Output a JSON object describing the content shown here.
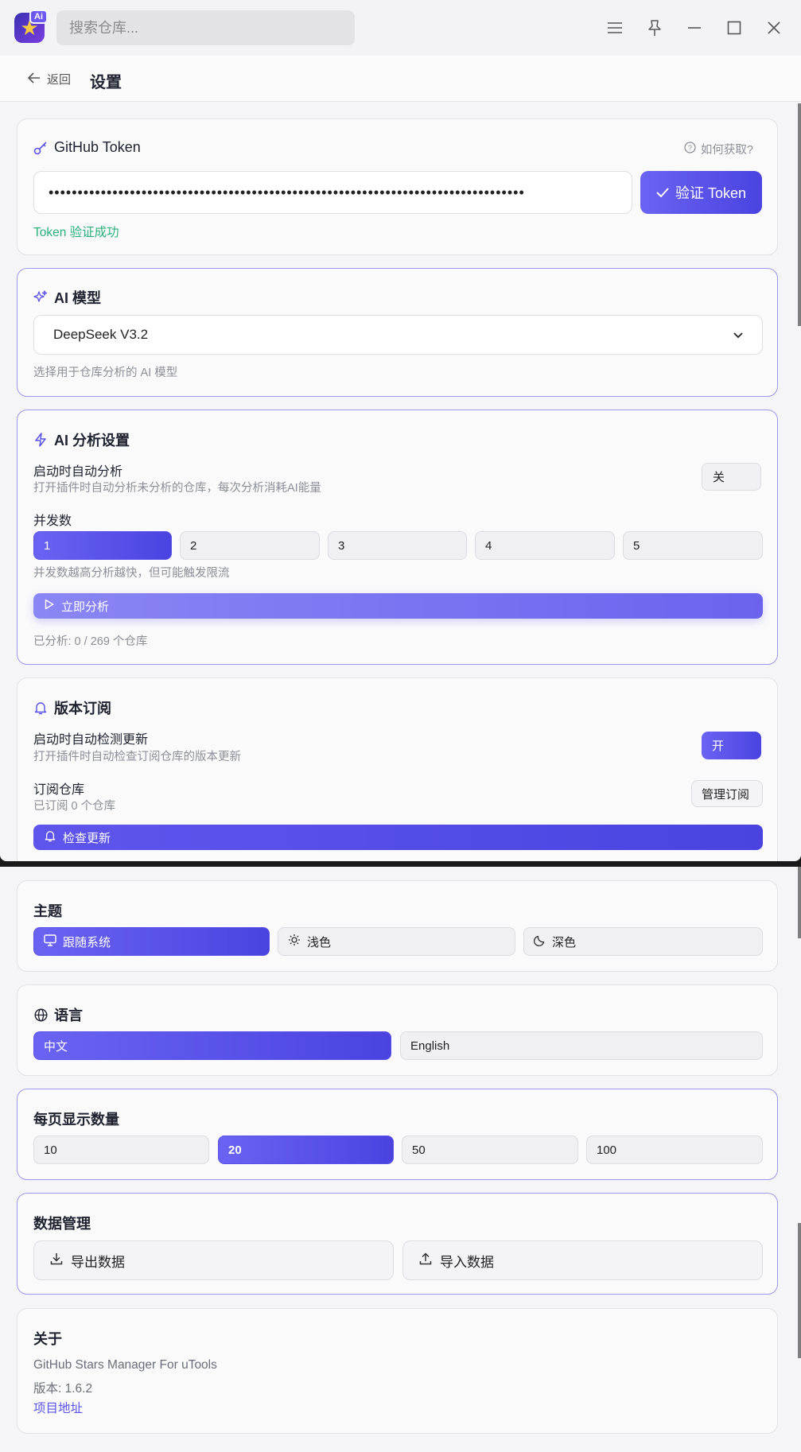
{
  "search": {
    "placeholder": "搜索仓库..."
  },
  "header": {
    "back_label": "返回",
    "title": "设置"
  },
  "token": {
    "title": "GitHub Token",
    "help": "如何获取?",
    "value": "••••••••••••••••••••••••••••••••••••••••••••••••••••••••••••••••••••••••••••••••••",
    "verify_label": "验证 Token",
    "status": "Token 验证成功"
  },
  "model": {
    "title": "AI 模型",
    "selected": "DeepSeek V3.2",
    "hint": "选择用于仓库分析的 AI 模型"
  },
  "analysis": {
    "title": "AI 分析设置",
    "auto_label": "启动时自动分析",
    "auto_hint": "打开插件时自动分析未分析的仓库，每次分析消耗AI能量",
    "auto_value": "关",
    "concurrency_label": "并发数",
    "concurrency_options": [
      "1",
      "2",
      "3",
      "4",
      "5"
    ],
    "concurrency_selected": 1,
    "concurrency_hint": "并发数越高分析越快，但可能触发限流",
    "analyze_label": "立即分析",
    "progress": "已分析: 0 / 269 个仓库"
  },
  "subscription": {
    "title": "版本订阅",
    "auto_label": "启动时自动检测更新",
    "auto_hint": "打开插件时自动检查订阅仓库的版本更新",
    "auto_value": "开",
    "repo_label": "订阅仓库",
    "repo_hint": "已订阅 0 个仓库",
    "manage_label": "管理订阅",
    "check_label": "检查更新"
  },
  "theme": {
    "title": "主题",
    "options": [
      "跟随系统",
      "浅色",
      "深色"
    ],
    "selected": "跟随系统"
  },
  "language": {
    "title": "语言",
    "options": [
      "中文",
      "English"
    ],
    "selected": "中文"
  },
  "page_size": {
    "title": "每页显示数量",
    "options": [
      "10",
      "20",
      "50",
      "100"
    ],
    "selected": "20"
  },
  "data_mgmt": {
    "title": "数据管理",
    "export_label": "导出数据",
    "import_label": "导入数据"
  },
  "about": {
    "title": "关于",
    "name": "GitHub Stars Manager For uTools",
    "version": "版本: 1.6.2",
    "link": "项目地址"
  },
  "colors": {
    "accent": "#5a52e8",
    "success": "#2bb07a",
    "link": "#5a52e8"
  }
}
